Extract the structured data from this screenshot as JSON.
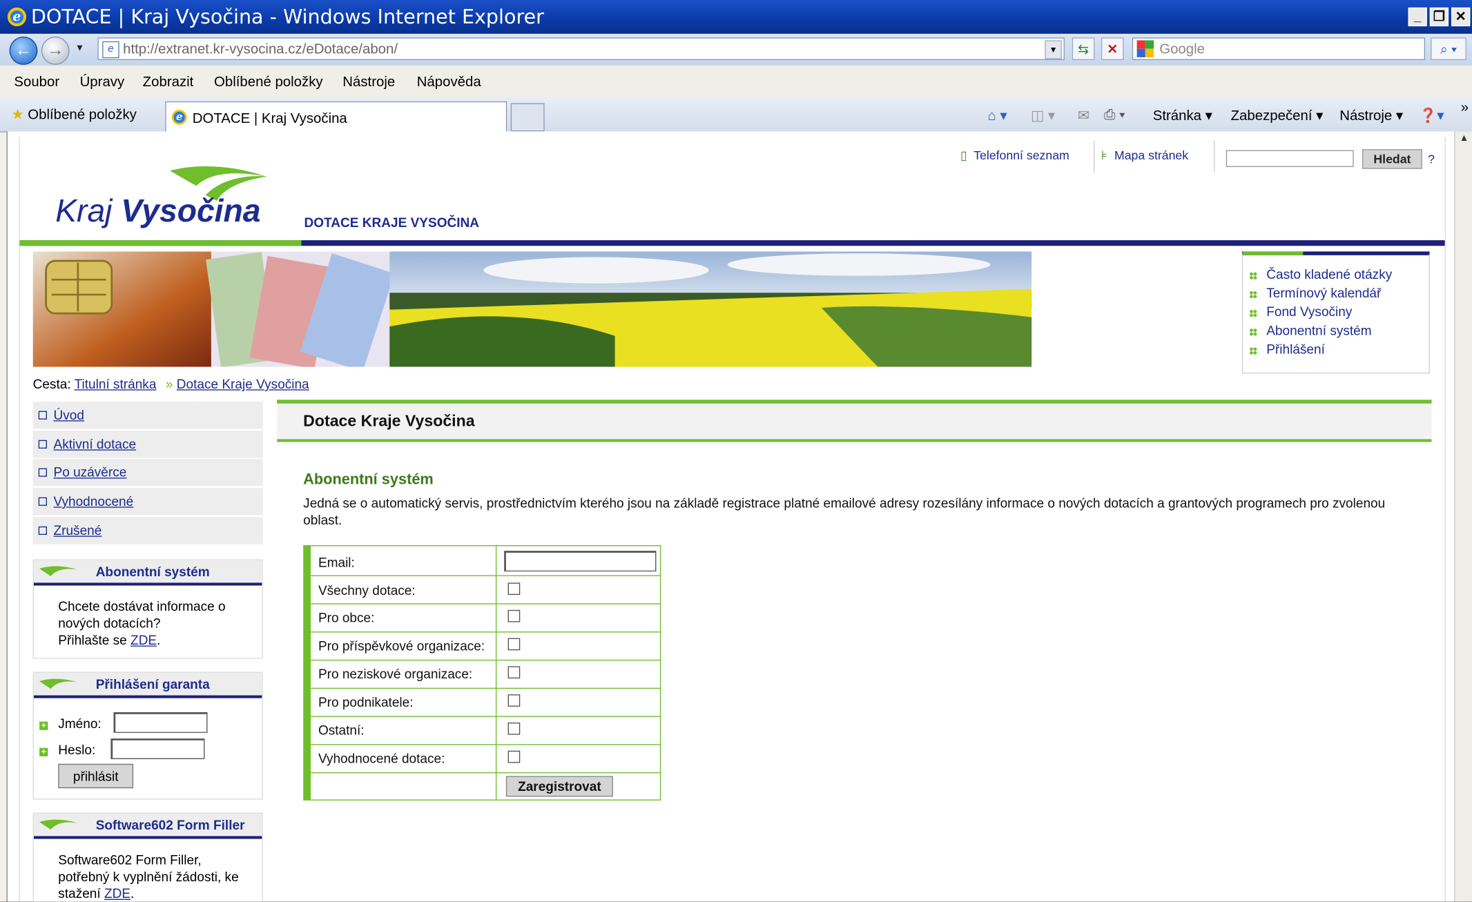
{
  "window": {
    "title": "DOTACE | Kraj Vysočina - Windows Internet Explorer"
  },
  "address": {
    "url": "http://extranet.kr-vysocina.cz/eDotace/abon/",
    "search_placeholder": "Google"
  },
  "menu": [
    "Soubor",
    "Úpravy",
    "Zobrazit",
    "Oblíbené položky",
    "Nástroje",
    "Nápověda"
  ],
  "favbar": {
    "favorites_label": "Oblíbené položky",
    "tab_title": "DOTACE | Kraj Vysočina",
    "stranka": "Stránka",
    "zabezpeceni": "Zabezpečení",
    "nastroje": "Nástroje"
  },
  "header": {
    "phone_link": "Telefonní seznam",
    "sitemap_link": "Mapa stránek",
    "search_button": "Hledat",
    "search_help": "?",
    "logo_kraj": "Kraj",
    "logo_vysocina": "Vysočina",
    "subtitle": "DOTACE KRAJE VYSOČINA"
  },
  "quick_links": [
    "Často kladené otázky",
    "Termínový kalendář",
    "Fond Vysočiny",
    "Abonentní systém",
    "Přihlášení"
  ],
  "breadcrumb": {
    "prefix": "Cesta:",
    "home": "Titulní stránka",
    "sep": "»",
    "current": "Dotace Kraje Vysočina"
  },
  "left_nav": [
    "Úvod",
    "Aktivní dotace",
    "Po uzávěrce",
    "Vyhodnocené",
    "Zrušené"
  ],
  "widget_abon": {
    "title": "Abonentní systém",
    "line1": "Chcete dostávat informace o",
    "line2": "nových dotacích?",
    "line3_prefix": "Přihlašte se ",
    "link": "ZDE",
    "dot": "."
  },
  "widget_login": {
    "title": "Přihlášení garanta",
    "name_label": "Jméno:",
    "pass_label": "Heslo:",
    "button": "přihlásit"
  },
  "widget_sw": {
    "title": "Software602 Form Filler",
    "line1": "Software602 Form Filler,",
    "line2": "potřebný k vyplnění žádosti, ke",
    "line3_prefix": "stažení ",
    "link": "ZDE",
    "dot": "."
  },
  "main": {
    "heading": "Dotace Kraje Vysočina",
    "section_title": "Abonentní systém",
    "description": "Jedná se o automatický servis, prostřednictvím kterého jsou na základě registrace platné emailové adresy rozesílány informace o nových dotacích a grantových programech pro zvolenou oblast.",
    "form": {
      "email_label": "Email:",
      "options": [
        "Všechny dotace:",
        "Pro obce:",
        "Pro příspěvkové organizace:",
        "Pro neziskové organizace:",
        "Pro podnikatele:",
        "Ostatní:",
        "Vyhodnocené dotace:"
      ],
      "submit": "Zaregistrovat"
    }
  }
}
